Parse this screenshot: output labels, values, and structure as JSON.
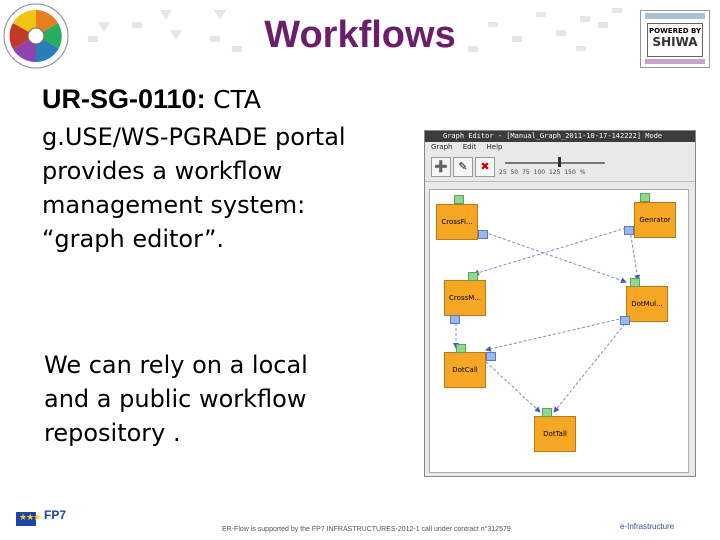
{
  "slide": {
    "title": "Workflows",
    "requirement_id": "UR-SG-0110:",
    "requirement_lead": "CTA",
    "body_lines": [
      "g.USE/WS-PGRADE portal",
      "provides a workflow",
      "management system:",
      "“graph editor”."
    ],
    "body2_lines": [
      "We can rely on a local",
      "and a public workflow",
      "repository ."
    ]
  },
  "logos": {
    "left_logo_icon": "er-flow-wheel-logo",
    "right_logo_icon": "powered-by-shiwa-logo",
    "right_logo_text": "POWERED BY",
    "right_logo_brand": "SHIWA"
  },
  "graph_editor": {
    "window_title": "Graph Editor - [Manual_Graph_2011-10-17-142222]  Mode",
    "menus": [
      "Graph",
      "Edit",
      "Help"
    ],
    "toolbar_icons": [
      "new-node-icon",
      "edit-node-icon",
      "delete-node-icon"
    ],
    "zoom_label": "25 50 75 100 125 150 %",
    "nodes": [
      {
        "id": "n1",
        "label": "CrossFi..."
      },
      {
        "id": "n2",
        "label": "Genrator"
      },
      {
        "id": "n3",
        "label": "CrossM..."
      },
      {
        "id": "n4",
        "label": "DotMul..."
      },
      {
        "id": "n5",
        "label": "DotCall"
      },
      {
        "id": "n6",
        "label": "DotTall"
      }
    ]
  },
  "footer": {
    "eu_label": "★★★",
    "fp7_label": "FP7",
    "text": "ER-Flow is supported by the FP7 INFRASTRUCTURES-2012-1 call under contract n°312579",
    "partner": "e-Infrastructure"
  },
  "colors": {
    "title": "#6b1e6a",
    "node": "#f5a623",
    "in_port": "#8fd88f",
    "out_port": "#9ab7ee"
  }
}
